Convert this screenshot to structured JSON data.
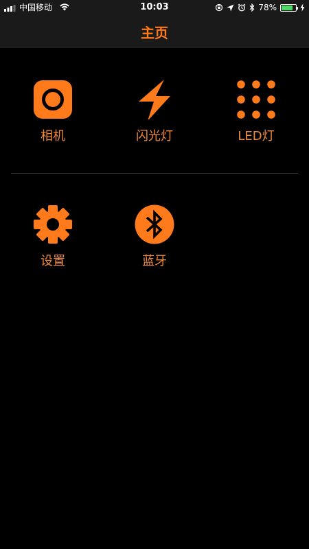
{
  "status_bar": {
    "carrier": "中国移动",
    "time": "10:03",
    "battery_percent": "78%",
    "battery_level": 0.78,
    "battery_color": "#4cd964"
  },
  "nav": {
    "title": "主页"
  },
  "accent_color": "#ff7a1a",
  "menu": {
    "camera": {
      "label": "相机",
      "icon": "camera-icon"
    },
    "flashlight": {
      "label": "闪光灯",
      "icon": "lightning-icon"
    },
    "led": {
      "label": "LED灯",
      "icon": "led-dots-icon"
    },
    "settings": {
      "label": "设置",
      "icon": "gear-icon"
    },
    "bluetooth": {
      "label": "蓝牙",
      "icon": "bluetooth-icon"
    }
  }
}
